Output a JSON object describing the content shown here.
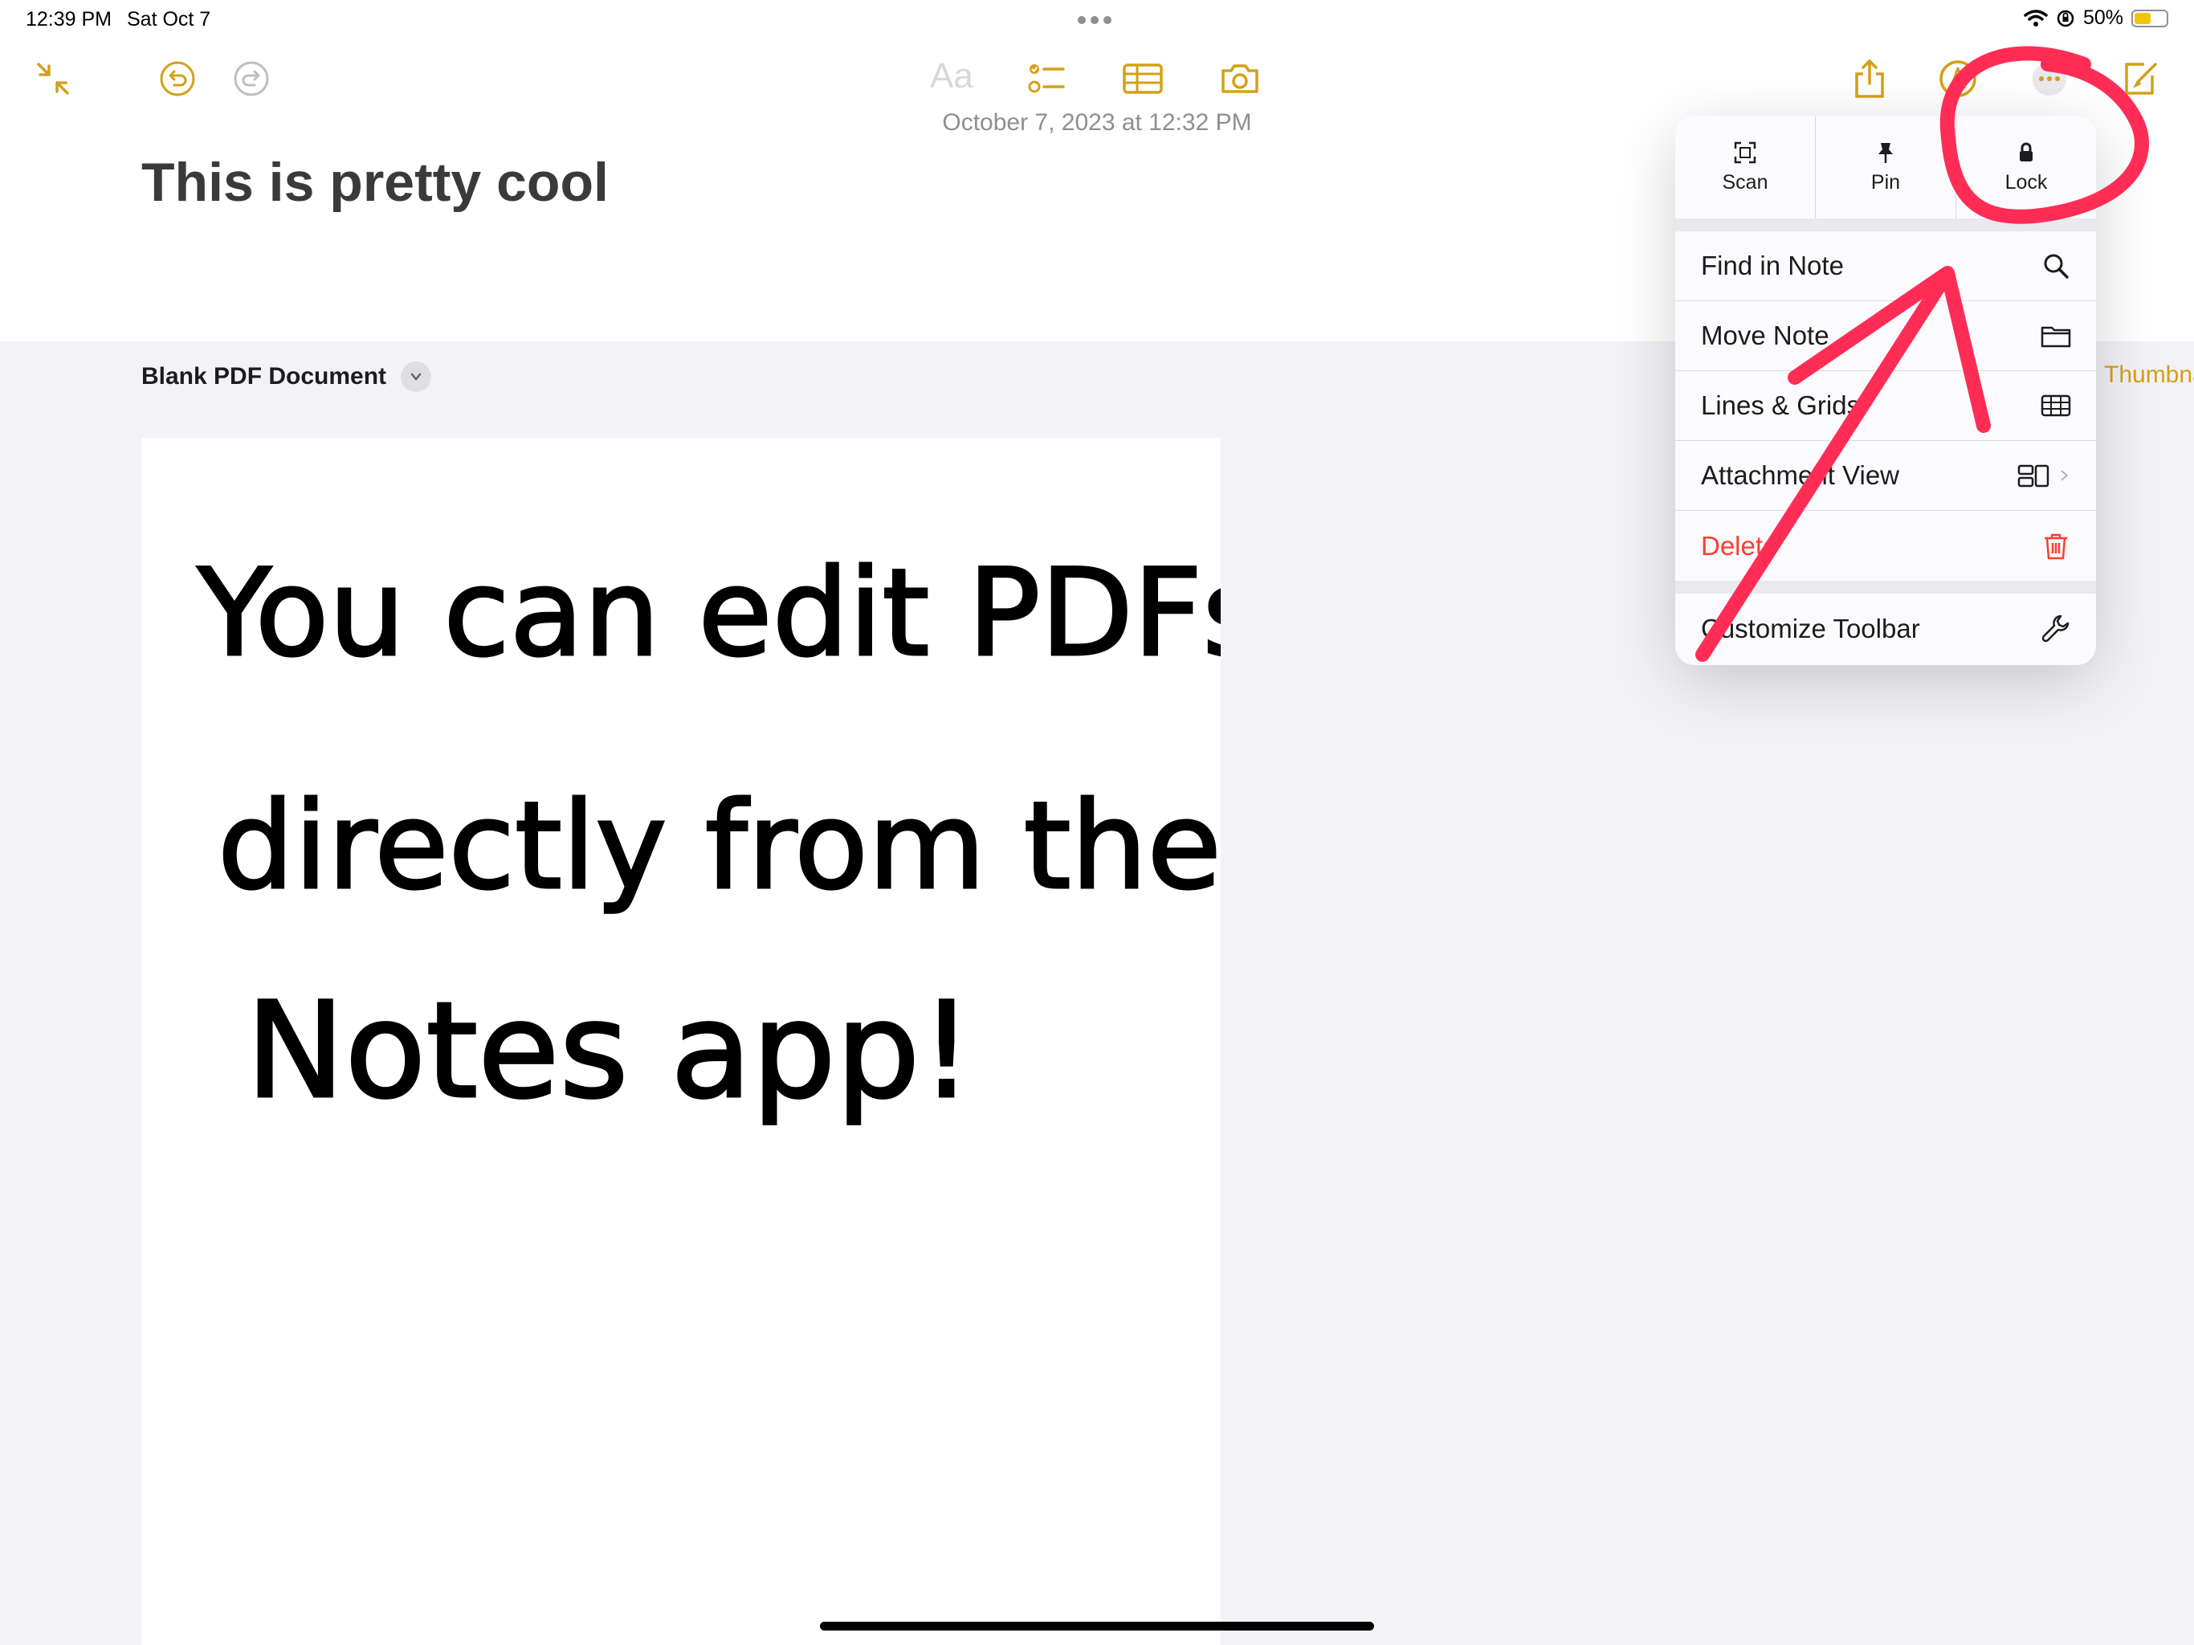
{
  "status_bar": {
    "time": "12:39 PM",
    "date": "Sat Oct 7",
    "battery": "50%",
    "battery_level": 0.5
  },
  "toolbar": {
    "text_format_label": "Aa",
    "icons": [
      "collapse-icon",
      "undo-icon",
      "redo-icon",
      "checklist-icon",
      "table-icon",
      "camera-icon",
      "share-icon",
      "markup-icon",
      "more-icon",
      "compose-icon"
    ],
    "accent": "#d4a017"
  },
  "note": {
    "date": "October 7, 2023 at 12:32 PM",
    "title": "This is pretty cool",
    "attachment_title": "Blank PDF Document",
    "thumbnails_link": "Thumbnails",
    "handwriting": [
      "You can edit PDFs",
      "directly from the",
      "Notes app!"
    ]
  },
  "menu": {
    "top": [
      {
        "label": "Scan",
        "icon": "scan-icon"
      },
      {
        "label": "Pin",
        "icon": "pin-icon"
      },
      {
        "label": "Lock",
        "icon": "lock-icon"
      }
    ],
    "items": [
      {
        "label": "Find in Note",
        "icon": "search-icon"
      },
      {
        "label": "Move Note",
        "icon": "folder-icon"
      },
      {
        "label": "Lines & Grids",
        "icon": "grid-icon"
      },
      {
        "label": "Attachment View",
        "icon": "attachment-view-icon"
      },
      {
        "label": "Delete",
        "icon": "trash-icon",
        "color": "#ff3b30"
      },
      {
        "label": "Customize Toolbar",
        "icon": "wrench-icon"
      }
    ]
  },
  "annotation_color": "#ff2d55"
}
